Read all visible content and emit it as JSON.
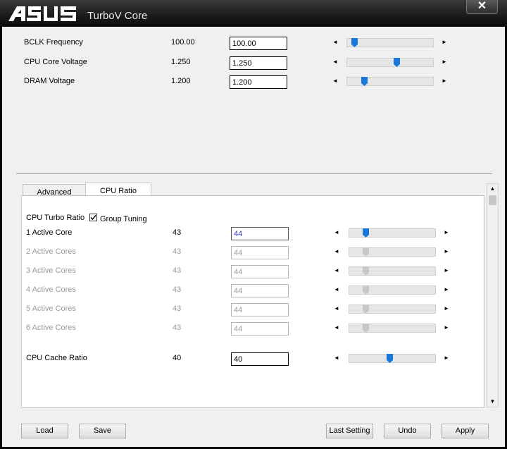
{
  "app": {
    "title": "TurboV Core",
    "logo_text": "ASUS",
    "close_glyph": "✕"
  },
  "colors": {
    "accent": "#1a78d8",
    "disabled_thumb": "#c8c8c8"
  },
  "top_settings": [
    {
      "label": "BCLK Frequency",
      "current": "100.00",
      "input": "100.00",
      "slider_fraction": 0.05
    },
    {
      "label": "CPU Core Voltage",
      "current": "1.250",
      "input": "1.250",
      "slider_fraction": 0.58
    },
    {
      "label": "DRAM Voltage",
      "current": "1.200",
      "input": "1.200",
      "slider_fraction": 0.18
    }
  ],
  "tabs": [
    {
      "label": "Advanced",
      "active": false
    },
    {
      "label": "CPU Ratio",
      "active": true
    }
  ],
  "cpu_ratio": {
    "turbo_label": "CPU Turbo Ratio",
    "group_tuning_label": "Group Tuning",
    "group_tuning_checked": true,
    "cores": [
      {
        "label": "1 Active Core",
        "current": "43",
        "input": "44",
        "enabled": true,
        "slider_fraction": 0.17
      },
      {
        "label": "2 Active Cores",
        "current": "43",
        "input": "44",
        "enabled": false,
        "slider_fraction": 0.17
      },
      {
        "label": "3 Active Cores",
        "current": "43",
        "input": "44",
        "enabled": false,
        "slider_fraction": 0.17
      },
      {
        "label": "4 Active Cores",
        "current": "43",
        "input": "44",
        "enabled": false,
        "slider_fraction": 0.17
      },
      {
        "label": "5 Active Cores",
        "current": "43",
        "input": "44",
        "enabled": false,
        "slider_fraction": 0.17
      },
      {
        "label": "6 Active Cores",
        "current": "43",
        "input": "44",
        "enabled": false,
        "slider_fraction": 0.17
      }
    ],
    "cache": {
      "label": "CPU Cache Ratio",
      "current": "40",
      "input": "40",
      "slider_fraction": 0.47
    }
  },
  "arrows": {
    "left": "◄",
    "right": "►",
    "up": "▲",
    "down": "▼"
  },
  "buttons": {
    "load": "Load",
    "save": "Save",
    "last_setting": "Last Setting",
    "undo": "Undo",
    "apply": "Apply"
  }
}
